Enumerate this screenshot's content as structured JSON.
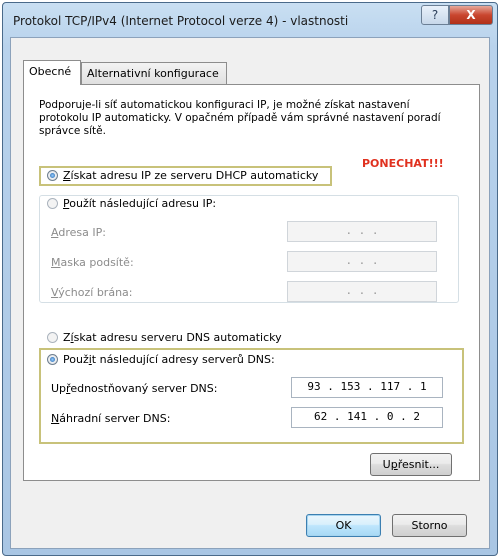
{
  "window": {
    "title": "Protokol TCP/IPv4 (Internet Protocol verze 4) - vlastnosti",
    "help_label": "?",
    "close_label": "X"
  },
  "tabs": [
    {
      "label": "Obecné"
    },
    {
      "label": "Alternativní konfigurace"
    }
  ],
  "description": "Podporuje-li síť automatickou konfiguraci IP, je možné získat nastavení protokolu IP automaticky. V opačném případě vám správné nastavení poradí správce sítě.",
  "annotation": "PONECHAT!!!",
  "ip_section": {
    "auto_ip": {
      "mnemonic": "Z",
      "rest": "ískat adresu IP ze serveru DHCP automaticky",
      "checked": true
    },
    "manual_ip": {
      "mnemonic": "P",
      "rest": "oužít následující adresu IP:",
      "checked": false
    },
    "fields": [
      {
        "mnemonic": "A",
        "rest": "dresa IP:",
        "value": ".       .       ."
      },
      {
        "mnemonic": "M",
        "rest": "aska podsítě:",
        "value": ".       .       ."
      },
      {
        "mnemonic": "V",
        "rest": "ýchozí brána:",
        "value": ".       .       ."
      }
    ]
  },
  "dns_section": {
    "auto_dns": {
      "pre": "Z",
      "mnemonic": "í",
      "rest": "skat adresu serveru DNS automaticky",
      "checked": false
    },
    "manual_dns": {
      "pre": "Použ",
      "mnemonic": "i",
      "rest": "t následující adresy serverů DNS:",
      "checked": true
    },
    "preferred": {
      "pre": "Up",
      "mnemonic": "ř",
      "rest": "ednostňovaný server DNS:",
      "value": "93 . 153 . 117 .  1"
    },
    "alternate": {
      "pre": "",
      "mnemonic": "N",
      "rest": "áhradní server DNS:",
      "value": "62 . 141 .  0  .  2"
    }
  },
  "buttons": {
    "advanced": {
      "pre": "U",
      "mnemonic": "p",
      "rest": "řesnit..."
    },
    "ok": "OK",
    "cancel": "Storno"
  },
  "colors": {
    "highlight_border": "#c8c27a",
    "annotation": "#e0311f",
    "titlebar": "#b8d2ec"
  }
}
